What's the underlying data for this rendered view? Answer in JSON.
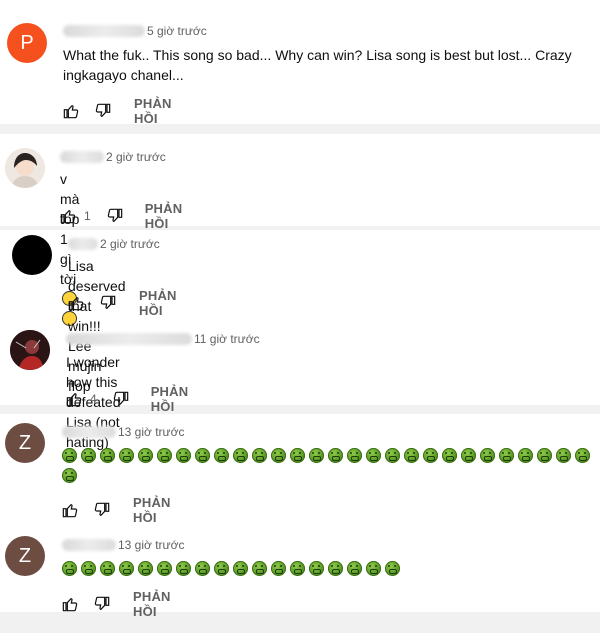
{
  "comments": [
    {
      "avatar_letter": "P",
      "avatar_color": "#f4511e",
      "time": "5 giờ trước",
      "text": "What the fuk.. This song so bad... Why can win? Lisa song is best but lost... Crazy ingkagayo chanel...",
      "likes": "",
      "reply": "PHẢN HỒI"
    },
    {
      "avatar_letter": "",
      "avatar_color": "#e9e2dc",
      "time": "2 giờ trước",
      "text": "v mà top 1 gì tời",
      "likes": "1",
      "reply": "PHẢN HỒI"
    },
    {
      "avatar_letter": "",
      "avatar_color": "#000000",
      "time": "2 giờ trước",
      "text": "Lisa deserved that win!!! Lee mujin flop",
      "likes": "",
      "reply": "PHẢN HỒI"
    },
    {
      "avatar_letter": "",
      "avatar_color": "#3a1a1a",
      "time": "11 giờ trước",
      "text": "I wonder how this defeated Lisa (not hating)",
      "likes": "4",
      "reply": "PHẢN HỒI"
    },
    {
      "avatar_letter": "Z",
      "avatar_color": "#6d4c41",
      "time": "13 giờ trước",
      "text": "",
      "emoji_count": 29,
      "likes": "",
      "reply": "PHẢN HỒI"
    },
    {
      "avatar_letter": "Z",
      "avatar_color": "#6d4c41",
      "time": "13 giờ trước",
      "text": "",
      "emoji_count": 18,
      "likes": "",
      "reply": "PHẢN HỒI"
    }
  ],
  "icons": {
    "like": "thumbs-up-icon",
    "dislike": "thumbs-down-icon",
    "emoji_green": "sick-face-emoji",
    "emoji_smile": "smiling-face-emoji"
  }
}
